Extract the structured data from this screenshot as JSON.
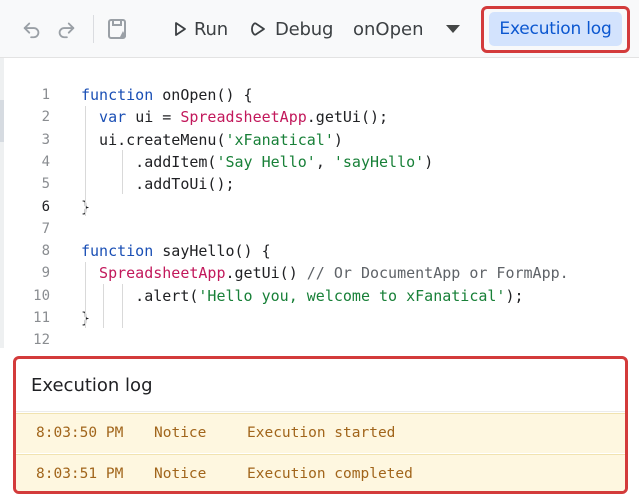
{
  "toolbar": {
    "undo_icon": "undo-icon",
    "redo_icon": "redo-icon",
    "save_icon": "save-drive-icon",
    "run_label": "Run",
    "debug_label": "Debug",
    "function_selector": "onOpen",
    "execution_log_label": "Execution log"
  },
  "editor": {
    "active_line": 6,
    "lines": [
      {
        "n": "1",
        "tokens": [
          {
            "t": "kw",
            "v": "function "
          },
          {
            "t": "plain",
            "v": "onOpen() {"
          }
        ]
      },
      {
        "n": "2",
        "tokens": [
          {
            "t": "kw",
            "v": "  var "
          },
          {
            "t": "plain",
            "v": "ui = "
          },
          {
            "t": "cls",
            "v": "SpreadsheetApp"
          },
          {
            "t": "plain",
            "v": ".getUi();"
          }
        ]
      },
      {
        "n": "3",
        "tokens": [
          {
            "t": "plain",
            "v": "  ui.createMenu("
          },
          {
            "t": "str",
            "v": "'xFanatical'"
          },
          {
            "t": "plain",
            "v": ")"
          }
        ]
      },
      {
        "n": "4",
        "tokens": [
          {
            "t": "plain",
            "v": "      .addItem("
          },
          {
            "t": "str",
            "v": "'Say Hello'"
          },
          {
            "t": "plain",
            "v": ", "
          },
          {
            "t": "str",
            "v": "'sayHello'"
          },
          {
            "t": "plain",
            "v": ")"
          }
        ]
      },
      {
        "n": "5",
        "tokens": [
          {
            "t": "plain",
            "v": "      .addToUi();"
          }
        ]
      },
      {
        "n": "6",
        "tokens": [
          {
            "t": "plain",
            "v": "}"
          }
        ]
      },
      {
        "n": "7",
        "tokens": []
      },
      {
        "n": "8",
        "tokens": [
          {
            "t": "kw",
            "v": "function "
          },
          {
            "t": "plain",
            "v": "sayHello() {"
          }
        ]
      },
      {
        "n": "9",
        "tokens": [
          {
            "t": "cls",
            "v": "  SpreadsheetApp"
          },
          {
            "t": "plain",
            "v": ".getUi() "
          },
          {
            "t": "cmt",
            "v": "// Or DocumentApp or FormApp."
          }
        ]
      },
      {
        "n": "10",
        "tokens": [
          {
            "t": "plain",
            "v": "      .alert("
          },
          {
            "t": "str",
            "v": "'Hello you, welcome to xFanatical'"
          },
          {
            "t": "plain",
            "v": ");"
          }
        ]
      },
      {
        "n": "11",
        "tokens": [
          {
            "t": "plain",
            "v": "}"
          }
        ]
      },
      {
        "n": "12",
        "tokens": []
      }
    ]
  },
  "execution_log": {
    "title": "Execution log",
    "entries": [
      {
        "time": "8:03:50 PM",
        "level": "Notice",
        "message": "Execution started"
      },
      {
        "time": "8:03:51 PM",
        "level": "Notice",
        "message": "Execution completed"
      }
    ]
  },
  "colors": {
    "accent_blue": "#0b57d0",
    "highlight_red": "#d33b3b",
    "log_background": "#fef7e0",
    "keyword": "#1a4fb5",
    "class_name": "#c2185b",
    "string": "#188038"
  }
}
